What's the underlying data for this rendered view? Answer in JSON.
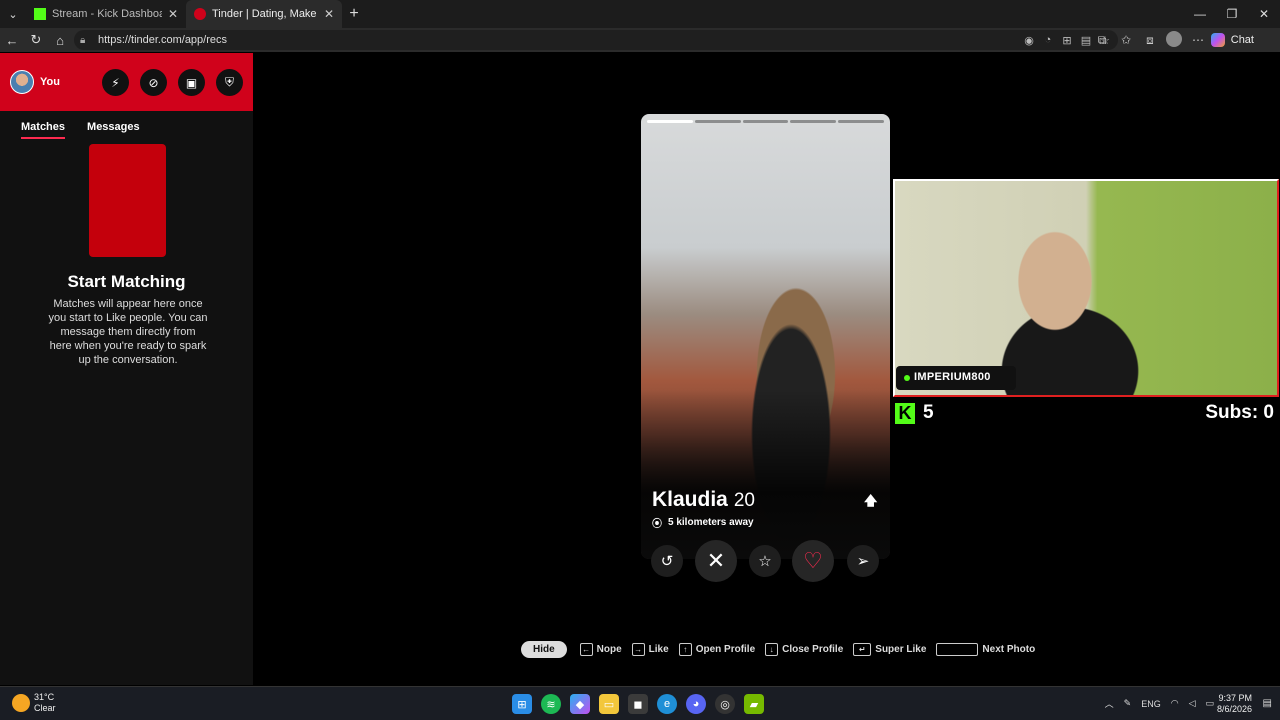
{
  "browser": {
    "tabs": [
      {
        "title": "Stream - Kick Dashboard",
        "favicon_color": "#53fc18"
      },
      {
        "title": "Tinder | Dating, Make Friends & M",
        "favicon_color": "#d0021b"
      }
    ],
    "url": "https://tinder.com/app/recs",
    "chat_label": "Chat"
  },
  "sidebar": {
    "user_label": "You",
    "tabs": [
      "Matches",
      "Messages"
    ],
    "empty_title": "Start Matching",
    "empty_desc": "Matches will appear here once you start to Like people. You can message them directly from here when you're ready to spark up the conversation."
  },
  "profile": {
    "name": "Klaudia",
    "age": "20",
    "distance": "5 kilometers away",
    "photo_count": 5,
    "current_photo": 1
  },
  "stream": {
    "channel": "IMPERIUM800",
    "viewers": "5",
    "subs": "Subs: 0"
  },
  "hints": {
    "hide": "Hide",
    "nope": "Nope",
    "like": "Like",
    "open_profile": "Open Profile",
    "close_profile": "Close Profile",
    "super_like": "Super Like",
    "next_photo": "Next Photo"
  },
  "taskbar": {
    "temp": "31°C",
    "condition": "Clear",
    "lang": "ENG",
    "time": "9:37 PM",
    "date": "8/6/2026"
  },
  "colors": {
    "brand": "#d0021b",
    "like": "#fd2b50",
    "kick": "#53fc18"
  }
}
